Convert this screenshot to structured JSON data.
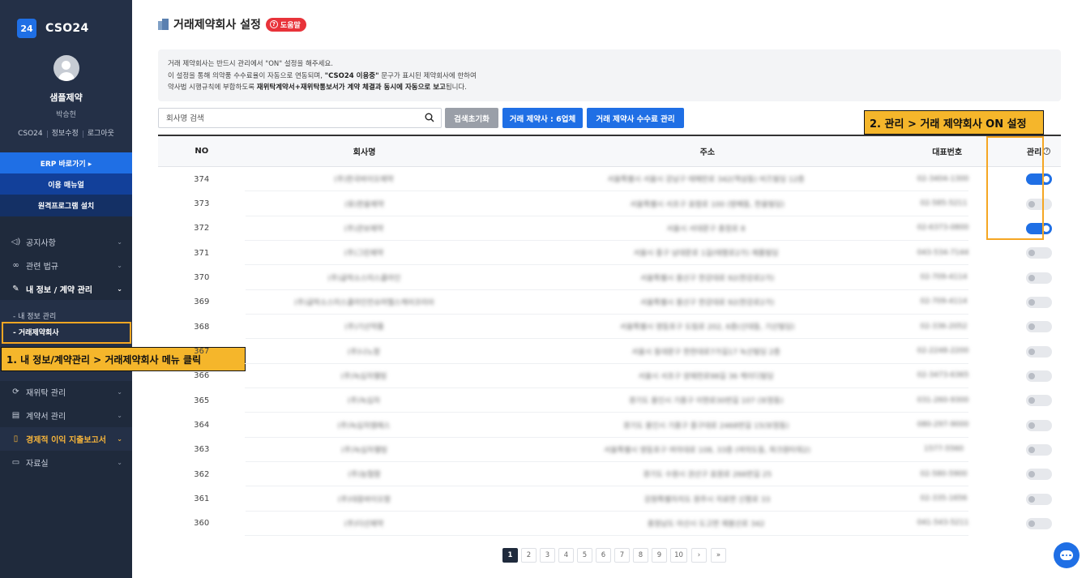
{
  "app": {
    "logo_badge": "24",
    "logo_text": "CSO24"
  },
  "profile": {
    "company": "샘플제약",
    "person": "박승현",
    "links": [
      "CSO24",
      "정보수정",
      "로그아웃"
    ]
  },
  "quick_buttons": {
    "erp": "ERP 바로가기 ▸",
    "manual": "이용 매뉴얼",
    "remote": "원격프로그램 설치"
  },
  "nav": {
    "notice": "공지사항",
    "law": "관련 법규",
    "myinfo": "내 정보 / 계약 관리",
    "sub_myinfo": "- 내 정보 관리",
    "sub_partner": "- 거래제약회사",
    "consign": "재위탁 관리",
    "contract": "계약서 관리",
    "econ": "경제적 이익 지출보고서",
    "archive": "자료실"
  },
  "annotations": {
    "step1": "1. 내 정보/계약관리 > 거래제약회사 메뉴 클릭",
    "step2": "2. 관리 > 거래 제약회사 ON 설정"
  },
  "page": {
    "title": "거래제약회사 설정",
    "help": "도움말"
  },
  "notice": {
    "line1": "거래 제약회사는 반드시 관리에서 \"ON\" 설정을 해주세요.",
    "line2_a": "이 설정을 통해 의약품 수수료율이 자동으로 연동되며, ",
    "line2_b": "\"CSO24 이용중\"",
    "line2_c": " 문구가 표시된 제약회사에 한하여",
    "line3_a": "약사법 시행규칙에 부합하도록 ",
    "line3_b": "재위탁계약서+재위탁통보서가 계약 체결과 동시에 자동으로 보고",
    "line3_c": "됩니다."
  },
  "toolbar": {
    "search_placeholder": "회사명 검색",
    "reset": "검색초기화",
    "trade_count": "거래 제약사 : 6업체",
    "fee": "거래 제약사 수수료 관리"
  },
  "table": {
    "headers": {
      "no": "NO",
      "name": "회사명",
      "addr": "주소",
      "tel": "대표번호",
      "manage": "관리"
    },
    "rows": [
      {
        "no": "374",
        "name": "(주)한국바이오제약",
        "addr": "서울특별시 서울시 강남구 테헤란로 342(역삼동) 비즈빌딩 12층",
        "tel": "02-3404-1300",
        "on": true
      },
      {
        "no": "373",
        "name": "(유)한울제약",
        "addr": "서울특별시 서초구 효령로 100 (방배동, 한울빌딩)",
        "tel": "02-585-5211",
        "on": false
      },
      {
        "no": "372",
        "name": "(주)관보제약",
        "addr": "서울시 서대문구 충정로 8",
        "tel": "02-6373-0800",
        "on": true
      },
      {
        "no": "371",
        "name": "(주)그린제약",
        "addr": "서울시 중구 남대문로 1길(태평로2가) 제품빌딩",
        "tel": "043-534-7144",
        "on": false
      },
      {
        "no": "370",
        "name": "(주)글락소스미스클라인",
        "addr": "서울특별시 용산구 한강대로 92(한강로2가)",
        "tel": "02-709-4114",
        "on": false
      },
      {
        "no": "369",
        "name": "(주)글락소스미스클라인컨슈머헬스케어코리아",
        "addr": "서울특별시 용산구 한강대로 92(한강로2가)",
        "tel": "02-709-4114",
        "on": false
      },
      {
        "no": "368",
        "name": "(주)기산약품",
        "addr": "서울특별시 영등포구 도림로 202, 6층(신대동, 기산빌딩)",
        "tel": "02-336-2052",
        "on": false
      },
      {
        "no": "367",
        "name": "(주)나노팜",
        "addr": "서울시 동대문구 한천대로7가길17 녹산빌딩 2층",
        "tel": "02-2248-2200",
        "on": false
      },
      {
        "no": "366",
        "name": "(주)녹십자웰빙",
        "addr": "서울시 서초구 양재천로98길 36 케이디빌딩",
        "tel": "02-3473-6365",
        "on": false
      },
      {
        "no": "365",
        "name": "(주)녹십자",
        "addr": "경기도 용인시 기흥구 이현로30번길 107 (보정동)",
        "tel": "031-260-9300",
        "on": false
      },
      {
        "no": "364",
        "name": "(주)녹십자엠에스",
        "addr": "경기도 용인시 기흥구 중구대로 2468번길 15(보정동)",
        "tel": "080-297-9000",
        "on": false
      },
      {
        "no": "363",
        "name": "(주)녹십자웰빙",
        "addr": "서울특별시 영등포구 여의대로 108, 33층 (여의도동, 파크원타워2)",
        "tel": "1577-5560",
        "on": false
      },
      {
        "no": "362",
        "name": "(주)농협팜",
        "addr": "경기도 수원시 권선구 효원로 266번길 25",
        "tel": "02-580-5900",
        "on": false
      },
      {
        "no": "361",
        "name": "(주)대웅바이오팜",
        "addr": "강원특별자치도 원주시 치료면 신평로 33",
        "tel": "02-335-1656",
        "on": false
      },
      {
        "no": "360",
        "name": "(주)더선제약",
        "addr": "충청남도 아산시 도고면 제봉산로 342",
        "tel": "041-543-5211",
        "on": false
      }
    ]
  },
  "pagination": {
    "pages": [
      "1",
      "2",
      "3",
      "4",
      "5",
      "6",
      "7",
      "8",
      "9",
      "10"
    ],
    "current": "1",
    "next": "›",
    "last": "»"
  },
  "colors": {
    "sidebar_bg": "#1f2a3c",
    "primary": "#1f6fe5",
    "annotation": "#f5b62b",
    "help_red": "#e8333a"
  }
}
